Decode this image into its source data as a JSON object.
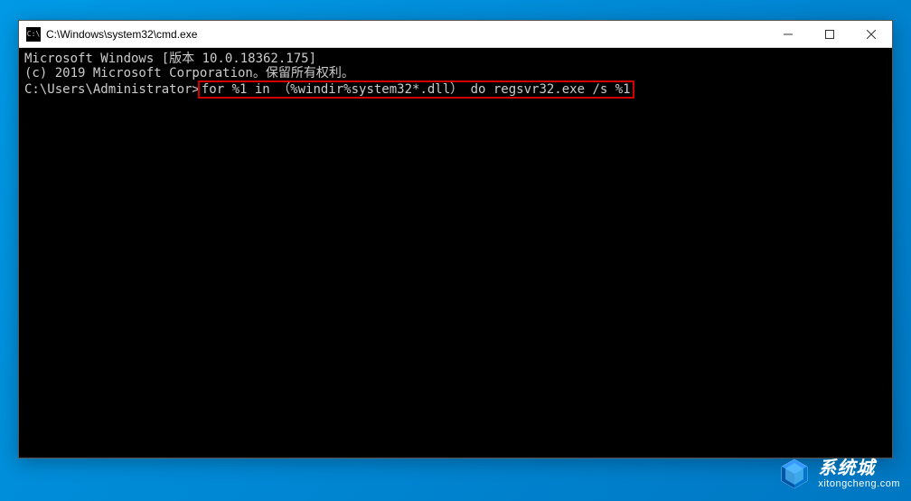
{
  "window": {
    "title": "C:\\Windows\\system32\\cmd.exe"
  },
  "terminal": {
    "line1": "Microsoft Windows [版本 10.0.18362.175]",
    "line2": "(c) 2019 Microsoft Corporation。保留所有权利。",
    "blank": "",
    "prompt": "C:\\Users\\Administrator>",
    "command": "for %1 in （%windir%system32*.dll） do regsvr32.exe /s %1"
  },
  "watermark": {
    "main": "系统城",
    "sub": "xitongcheng.com"
  }
}
